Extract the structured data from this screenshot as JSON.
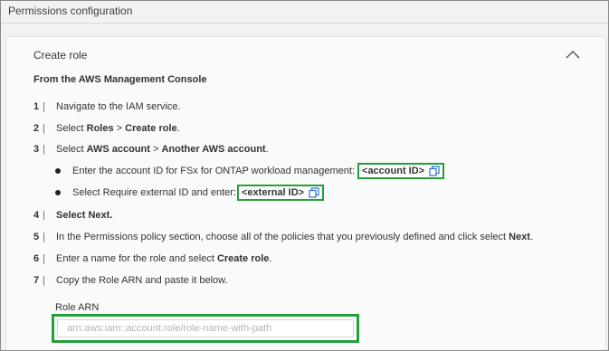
{
  "section": {
    "title": "Permissions configuration"
  },
  "panel": {
    "header": "Create role",
    "subheading": "From the AWS Management Console",
    "steps": [
      {
        "num": "1",
        "parts": [
          {
            "text": "Navigate to the IAM service.",
            "bold": false
          }
        ]
      },
      {
        "num": "2",
        "parts": [
          {
            "text": "Select ",
            "bold": false
          },
          {
            "text": "Roles",
            "bold": true
          },
          {
            "text": " > ",
            "bold": false
          },
          {
            "text": "Create role",
            "bold": true
          },
          {
            "text": ".",
            "bold": false
          }
        ]
      },
      {
        "num": "3",
        "parts": [
          {
            "text": "Select ",
            "bold": false
          },
          {
            "text": "AWS account",
            "bold": true
          },
          {
            "text": " > ",
            "bold": false
          },
          {
            "text": "Another AWS account",
            "bold": true
          },
          {
            "text": ".",
            "bold": false
          }
        ]
      },
      {
        "num": "4",
        "parts": [
          {
            "text": "Select ",
            "bold": true
          },
          {
            "text": "Next",
            "bold": true
          },
          {
            "text": ".",
            "bold": true
          }
        ]
      },
      {
        "num": "5",
        "parts": [
          {
            "text": "In the Permissions policy section, choose all of the policies that you previously defined and click select ",
            "bold": false
          },
          {
            "text": "Next",
            "bold": true
          },
          {
            "text": ".",
            "bold": false
          }
        ]
      },
      {
        "num": "6",
        "parts": [
          {
            "text": "Enter a name for the role and select ",
            "bold": false
          },
          {
            "text": "Create role",
            "bold": true
          },
          {
            "text": ".",
            "bold": false
          }
        ]
      },
      {
        "num": "7",
        "parts": [
          {
            "text": "Copy the Role ARN and paste it below.",
            "bold": false
          }
        ]
      }
    ],
    "bullets": [
      {
        "text": "Enter the account ID for FSx for ONTAP workload management:",
        "chip": "<account ID>"
      },
      {
        "text": "Select Require external ID and enter:",
        "chip": "<external ID>"
      }
    ],
    "role_arn": {
      "label": "Role ARN",
      "placeholder": "arn:aws:iam::account:role/role-name-with-path",
      "value": ""
    }
  },
  "colors": {
    "highlight": "#23a03b",
    "copy_icon": "#2f6fd6"
  },
  "icons": {
    "collapse": "chevron-up-icon",
    "copy": "copy-icon"
  }
}
